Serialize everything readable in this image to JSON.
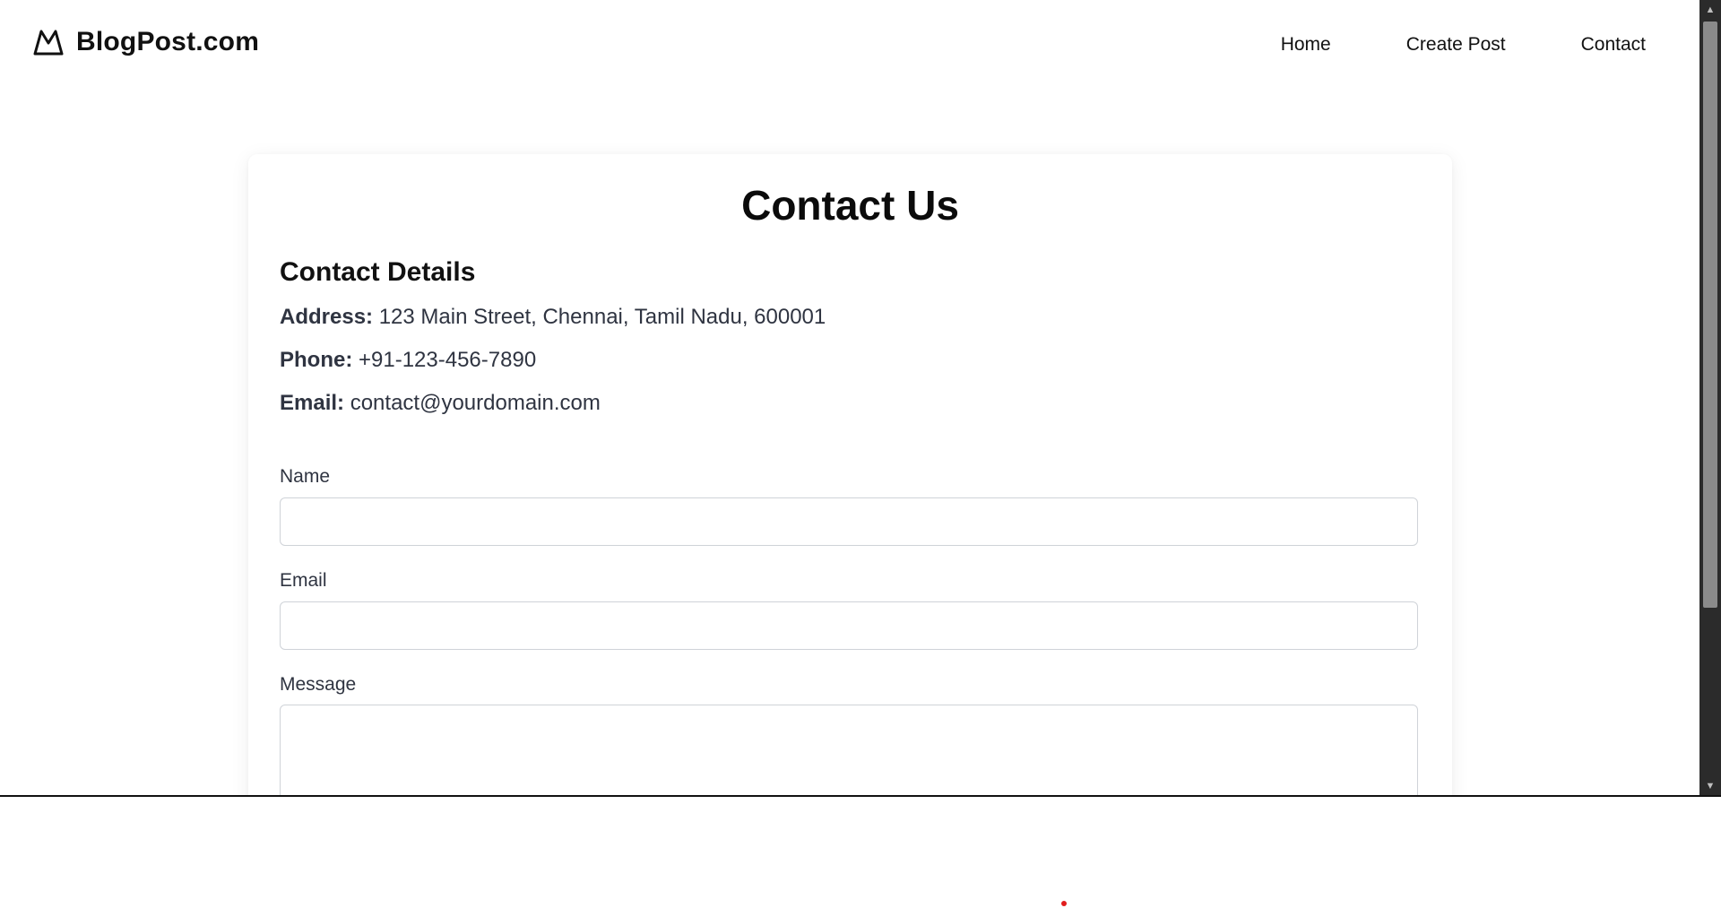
{
  "header": {
    "brand": "BlogPost.com",
    "logo_icon": "mountain-icon",
    "nav": [
      {
        "label": "Home"
      },
      {
        "label": "Create Post"
      },
      {
        "label": "Contact"
      }
    ]
  },
  "main": {
    "title": "Contact Us",
    "details_title": "Contact Details",
    "details": {
      "address_label": "Address:",
      "address_value": "123 Main Street, Chennai, Tamil Nadu, 600001",
      "phone_label": "Phone:",
      "phone_value": "+91-123-456-7890",
      "email_label": "Email:",
      "email_value": "contact@yourdomain.com"
    },
    "form": {
      "name_label": "Name",
      "name_value": "",
      "email_label": "Email",
      "email_value": "",
      "message_label": "Message",
      "message_value": ""
    }
  },
  "scrollbar": {
    "up_icon": "arrow-up-icon",
    "down_icon": "arrow-down-icon"
  },
  "colors": {
    "text_primary": "#111111",
    "text_secondary": "#2f3441",
    "input_border": "#cfd3d8",
    "scrollbar_track": "#2b2b2b",
    "scrollbar_thumb": "#8b8b8b",
    "dot": "#e11d1d"
  }
}
